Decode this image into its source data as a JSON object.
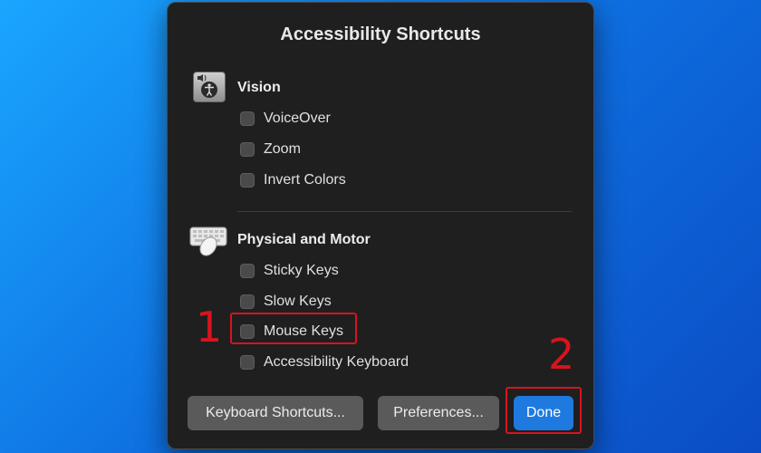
{
  "dialog": {
    "title": "Accessibility Shortcuts",
    "sections": [
      {
        "title": "Vision",
        "icon": "accessibility-icon",
        "items": [
          "VoiceOver",
          "Zoom",
          "Invert Colors"
        ]
      },
      {
        "title": "Physical and Motor",
        "icon": "keyboard-mouse-icon",
        "items": [
          "Sticky Keys",
          "Slow Keys",
          "Mouse Keys",
          "Accessibility Keyboard"
        ]
      }
    ],
    "buttons": {
      "keyboard_shortcuts": "Keyboard Shortcuts...",
      "preferences": "Preferences...",
      "done": "Done"
    }
  },
  "annotations": {
    "step1": "1",
    "step2": "2",
    "color": "#d6141f"
  },
  "colors": {
    "accent": "#1f7ae0",
    "dialog_bg": "#1f1f1f"
  }
}
